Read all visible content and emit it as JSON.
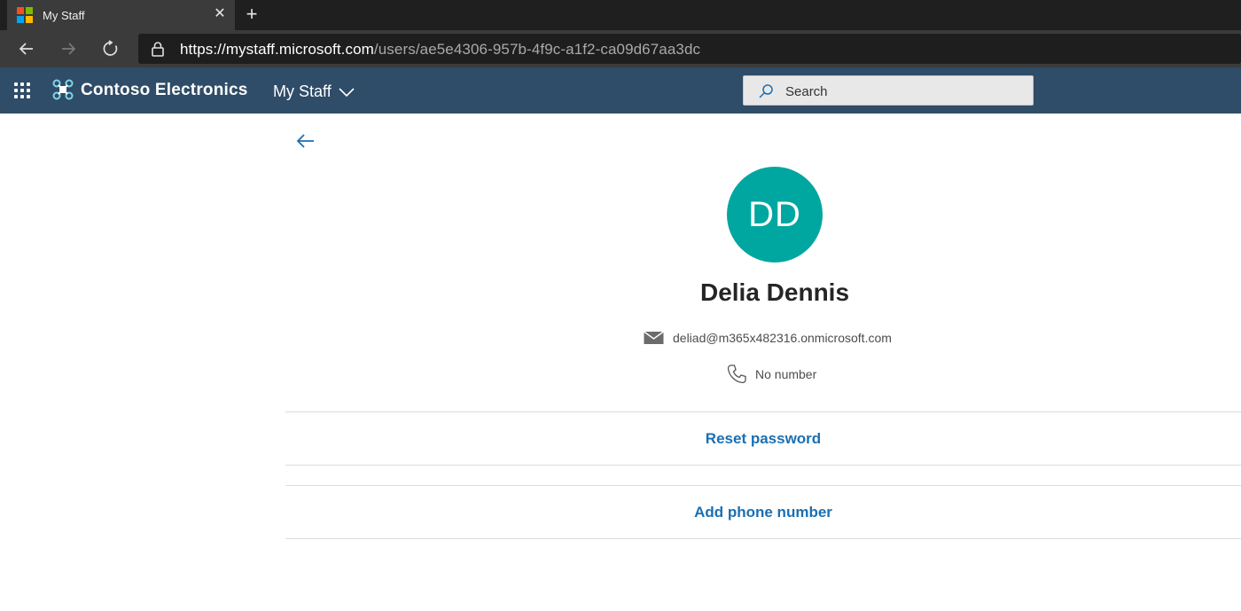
{
  "browser": {
    "tab_title": "My Staff",
    "tab_close_glyph": "✕",
    "new_tab_glyph": "+",
    "url_host": "https://mystaff.microsoft.com",
    "url_path": "/users/ae5e4306-957b-4f9c-a1f2-ca09d67aa3dc",
    "logo_colors": [
      "#f25022",
      "#7fba00",
      "#00a4ef",
      "#ffb900"
    ]
  },
  "header": {
    "org_name": "Contoso Electronics",
    "app_name": "My Staff",
    "search_placeholder": "Search",
    "background": "#2f4c68"
  },
  "profile": {
    "initials": "DD",
    "name": "Delia Dennis",
    "email": "deliad@m365x482316.onmicrosoft.com",
    "phone": "No number",
    "avatar_color": "#00a7a0"
  },
  "actions": {
    "reset_password": "Reset password",
    "add_phone": "Add phone number",
    "link_color": "#1a6fb3"
  }
}
